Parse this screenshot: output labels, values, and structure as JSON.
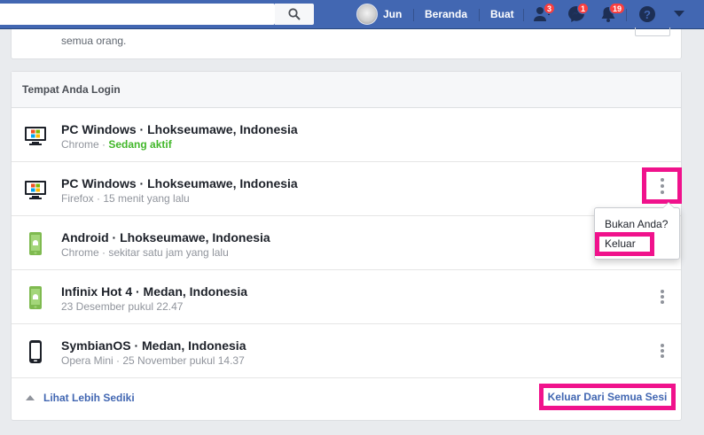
{
  "topbar": {
    "user_name": "Jun",
    "nav_home": "Beranda",
    "nav_create": "Buat",
    "friend_badge": "3",
    "message_badge": "1",
    "notification_badge": "19",
    "color": "#4267b2"
  },
  "prev_card": {
    "text": "semua orang."
  },
  "sessions": {
    "header": "Tempat Anda Login",
    "rows": [
      {
        "title": "PC Windows · Lhokseumawe, Indonesia",
        "browser": "Chrome",
        "separator": " · ",
        "status": "Sedang aktif",
        "device": "desktop"
      },
      {
        "title": "PC Windows · Lhokseumawe, Indonesia",
        "subtitle": "Firefox · 15 menit yang lalu",
        "device": "desktop"
      },
      {
        "title": "Android · Lhokseumawe, Indonesia",
        "subtitle": "Chrome · sekitar satu jam yang lalu",
        "device": "android"
      },
      {
        "title": "Infinix Hot 4 · Medan, Indonesia",
        "subtitle": "23 Desember pukul 22.47",
        "device": "android"
      },
      {
        "title": "SymbianOS · Medan, Indonesia",
        "subtitle": "Opera Mini · 25 November pukul 14.37",
        "device": "feature-phone"
      }
    ],
    "see_less": "Lihat Lebih Sediki",
    "logout_all": "Keluar Dari Semua Sesi"
  },
  "popover": {
    "title": "Bukan Anda?",
    "logout": "Keluar"
  },
  "colors": {
    "highlight": "#f0128c",
    "active": "#42b72a",
    "link": "#4267b2"
  }
}
